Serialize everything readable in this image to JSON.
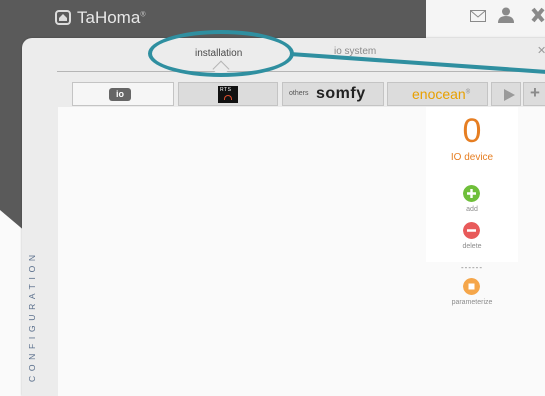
{
  "header": {
    "brand": "TaHoma",
    "brand_mark": "®",
    "icons": [
      "home-icon",
      "mail-icon",
      "user-icon",
      "close-icon"
    ]
  },
  "sidebar": {
    "label": "CONFIGURATION"
  },
  "tabs": [
    {
      "label": "installation",
      "active": true
    },
    {
      "label": "io system",
      "active": false
    }
  ],
  "protocols": [
    {
      "label": "io",
      "active": true
    },
    {
      "label": "RTS",
      "active": false
    },
    {
      "label": "others",
      "brand": "somfy",
      "active": false
    },
    {
      "label": "enocean",
      "mark": "®",
      "active": false
    },
    {
      "label": "next",
      "icon": "play-icon"
    },
    {
      "label": "+",
      "icon": "plus-icon"
    }
  ],
  "device_panel": {
    "count": "0",
    "count_label": "IO device",
    "actions": [
      {
        "label": "add",
        "icon": "plus-circle-icon"
      },
      {
        "label": "delete",
        "icon": "minus-circle-icon"
      },
      {
        "label": "parameterize",
        "icon": "stop-square-icon"
      }
    ],
    "separator": "------"
  },
  "colors": {
    "accent": "#e67e22",
    "highlight": "#2f8fa0",
    "add": "#6fbf3a",
    "delete": "#e85a5a",
    "parameterize": "#f5a64a"
  }
}
